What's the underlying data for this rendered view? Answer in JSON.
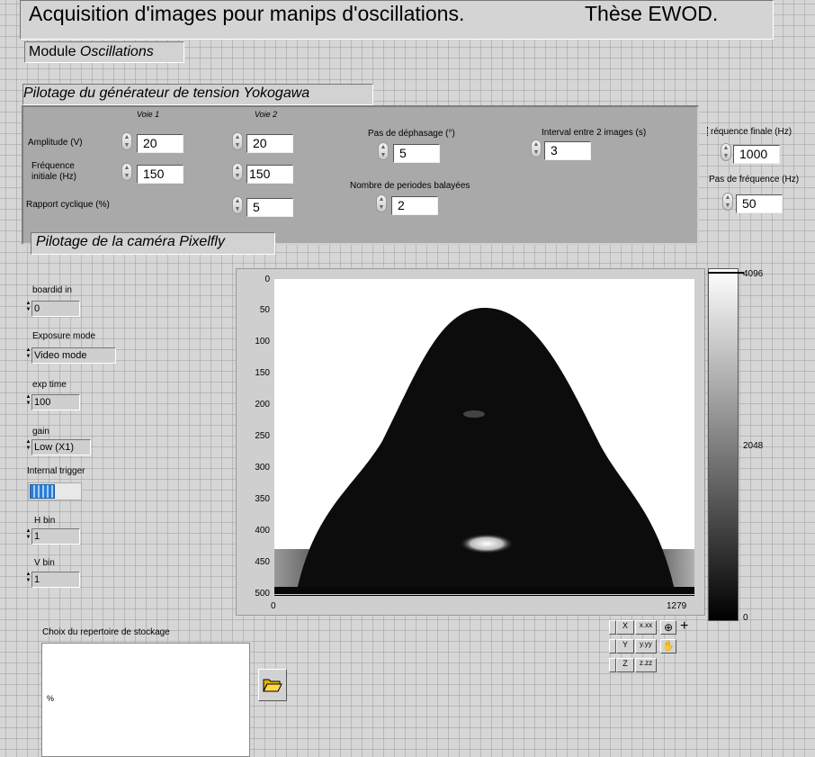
{
  "header": {
    "title": "Acquisition d'images pour manips d'oscillations.",
    "thesis": "Thèse EWOD."
  },
  "module": {
    "prefix": "Module ",
    "name": "Oscillations"
  },
  "generator": {
    "title": "Pilotage du générateur de tension Yokogawa",
    "voie1": "Voie 1",
    "voie2": "Voie 2",
    "amplitude_label": "Amplitude (V)",
    "amplitude_v1": "20",
    "amplitude_v2": "20",
    "freq_label_1": "Fréquence",
    "freq_label_2": "initiale (Hz)",
    "freq_v1": "150",
    "freq_v2": "150",
    "duty_label": "Rapport cyclique (%)",
    "duty_v2": "5",
    "phase_label": "Pas de déphasage (°)",
    "phase_value": "5",
    "periods_label": "Nombre de periodes balayées",
    "periods_value": "2",
    "interval_label": "Interval entre 2 images (s)",
    "interval_value": "3",
    "final_freq_label": "réquence finale (Hz)",
    "final_freq_value": "1000",
    "freq_step_label": "Pas de fréquence (Hz)",
    "freq_step_value": "50"
  },
  "camera": {
    "title": "Pilotage de la caméra Pixelfly",
    "boardid_label": "boardid in",
    "boardid_value": "0",
    "exposure_label": "Exposure mode",
    "exposure_value": "Video mode",
    "exptime_label": "exp time",
    "exptime_value": "100",
    "gain_label": "gain",
    "gain_value": "Low (X1)",
    "trigger_label": "Internal  trigger",
    "hbin_label": "H bin",
    "hbin_value": "1",
    "vbin_label": "V bin",
    "vbin_value": "1"
  },
  "graph": {
    "y_ticks": [
      "0",
      "50",
      "100",
      "150",
      "200",
      "250",
      "300",
      "350",
      "400",
      "450",
      "500"
    ],
    "x_min": "0",
    "x_max": "1279",
    "scale_max": "4096",
    "scale_mid": "2048",
    "scale_min": "0",
    "x_format": "x.xx",
    "y_format": "y.yy",
    "z_format": "z.zz"
  },
  "storage": {
    "label": "Choix du repertoire de stockage"
  }
}
